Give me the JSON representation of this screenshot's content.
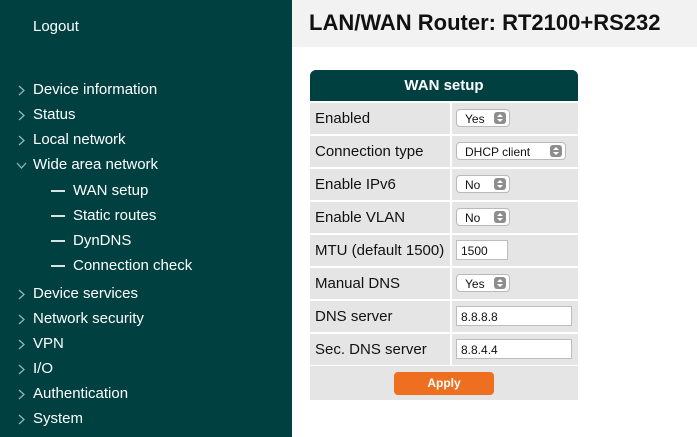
{
  "sidebar": {
    "logout": "Logout",
    "items": [
      {
        "label": "Device information"
      },
      {
        "label": "Status"
      },
      {
        "label": "Local network"
      },
      {
        "label": "Wide area network"
      },
      {
        "label": "Device services"
      },
      {
        "label": "Network security"
      },
      {
        "label": "VPN"
      },
      {
        "label": "I/O"
      },
      {
        "label": "Authentication"
      },
      {
        "label": "System"
      }
    ],
    "sub_items": [
      {
        "label": "WAN setup"
      },
      {
        "label": "Static routes"
      },
      {
        "label": "DynDNS"
      },
      {
        "label": "Connection check"
      }
    ]
  },
  "header": {
    "title": "LAN/WAN Router: RT2100+RS232"
  },
  "panel": {
    "title": "WAN setup",
    "rows": [
      {
        "label": "Enabled",
        "value": "Yes"
      },
      {
        "label": "Connection type",
        "value": "DHCP client"
      },
      {
        "label": "Enable IPv6",
        "value": "No"
      },
      {
        "label": "Enable VLAN",
        "value": "No"
      },
      {
        "label": "MTU (default 1500)",
        "value": "1500"
      },
      {
        "label": "Manual DNS",
        "value": "Yes"
      },
      {
        "label": "DNS server",
        "value": "8.8.8.8"
      },
      {
        "label": "Sec. DNS server",
        "value": "8.8.4.4"
      }
    ],
    "apply_label": "Apply"
  },
  "colors": {
    "sidebar_bg": "#004040",
    "row_bg": "#e5e5e5",
    "accent_button": "#ef6f21"
  }
}
